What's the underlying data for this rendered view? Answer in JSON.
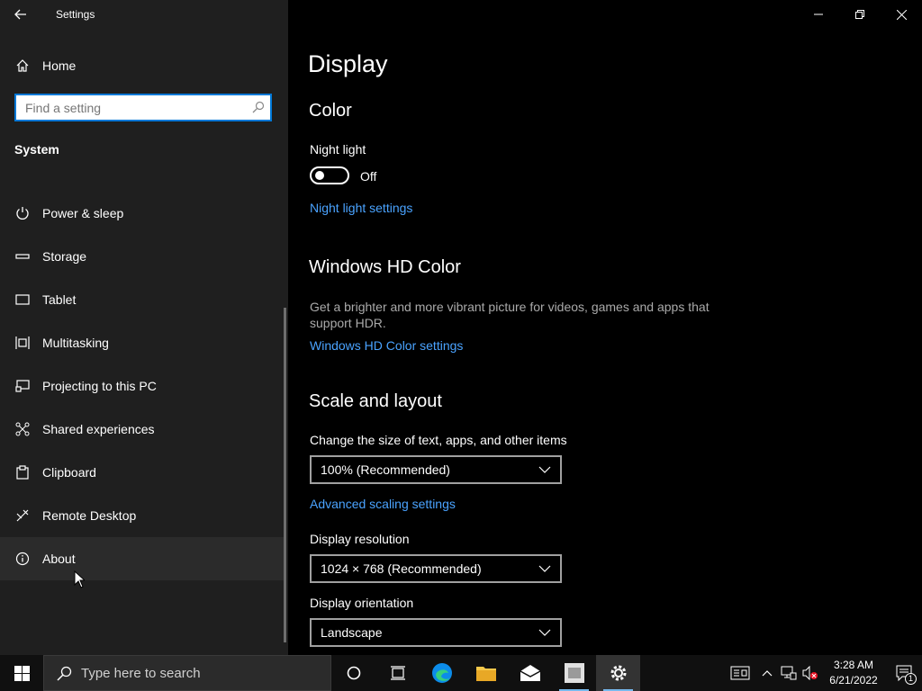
{
  "window": {
    "title": "Settings"
  },
  "sidebar": {
    "home_label": "Home",
    "search_placeholder": "Find a setting",
    "section": "System",
    "items": [
      {
        "label": "Power & sleep",
        "icon": "power-icon"
      },
      {
        "label": "Storage",
        "icon": "storage-icon"
      },
      {
        "label": "Tablet",
        "icon": "tablet-icon"
      },
      {
        "label": "Multitasking",
        "icon": "multitasking-icon"
      },
      {
        "label": "Projecting to this PC",
        "icon": "projecting-icon"
      },
      {
        "label": "Shared experiences",
        "icon": "shared-experiences-icon"
      },
      {
        "label": "Clipboard",
        "icon": "clipboard-icon"
      },
      {
        "label": "Remote Desktop",
        "icon": "remote-desktop-icon"
      },
      {
        "label": "About",
        "icon": "info-icon"
      }
    ]
  },
  "main": {
    "page_title": "Display",
    "color": {
      "heading": "Color",
      "night_light_label": "Night light",
      "night_light_state": "Off",
      "night_light_link": "Night light settings"
    },
    "hd_color": {
      "heading": "Windows HD Color",
      "description": "Get a brighter and more vibrant picture for videos, games and apps that support HDR.",
      "link": "Windows HD Color settings"
    },
    "scale": {
      "heading": "Scale and layout",
      "size_label": "Change the size of text, apps, and other items",
      "size_value": "100% (Recommended)",
      "advanced_link": "Advanced scaling settings",
      "resolution_label": "Display resolution",
      "resolution_value": "1024 × 768 (Recommended)",
      "orientation_label": "Display orientation",
      "orientation_value": "Landscape"
    }
  },
  "taskbar": {
    "search_placeholder": "Type here to search",
    "time": "3:28 AM",
    "date": "6/21/2022",
    "notification_count": "1"
  }
}
